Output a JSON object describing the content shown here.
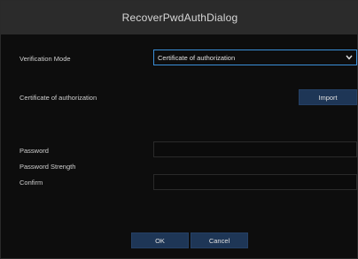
{
  "dialog": {
    "title": "RecoverPwdAuthDialog"
  },
  "fields": {
    "verification_mode_label": "Verification Mode",
    "verification_mode_value": "Certificate of authorization",
    "certificate_label": "Certificate of authorization",
    "import_label": "Import",
    "password_label": "Password",
    "password_strength_label": "Password Strength",
    "confirm_label": "Confirm"
  },
  "buttons": {
    "ok": "OK",
    "cancel": "Cancel"
  },
  "colors": {
    "accent": "#3a8fd8",
    "button": "#1e3656",
    "titlebar": "#2b2b2b"
  }
}
